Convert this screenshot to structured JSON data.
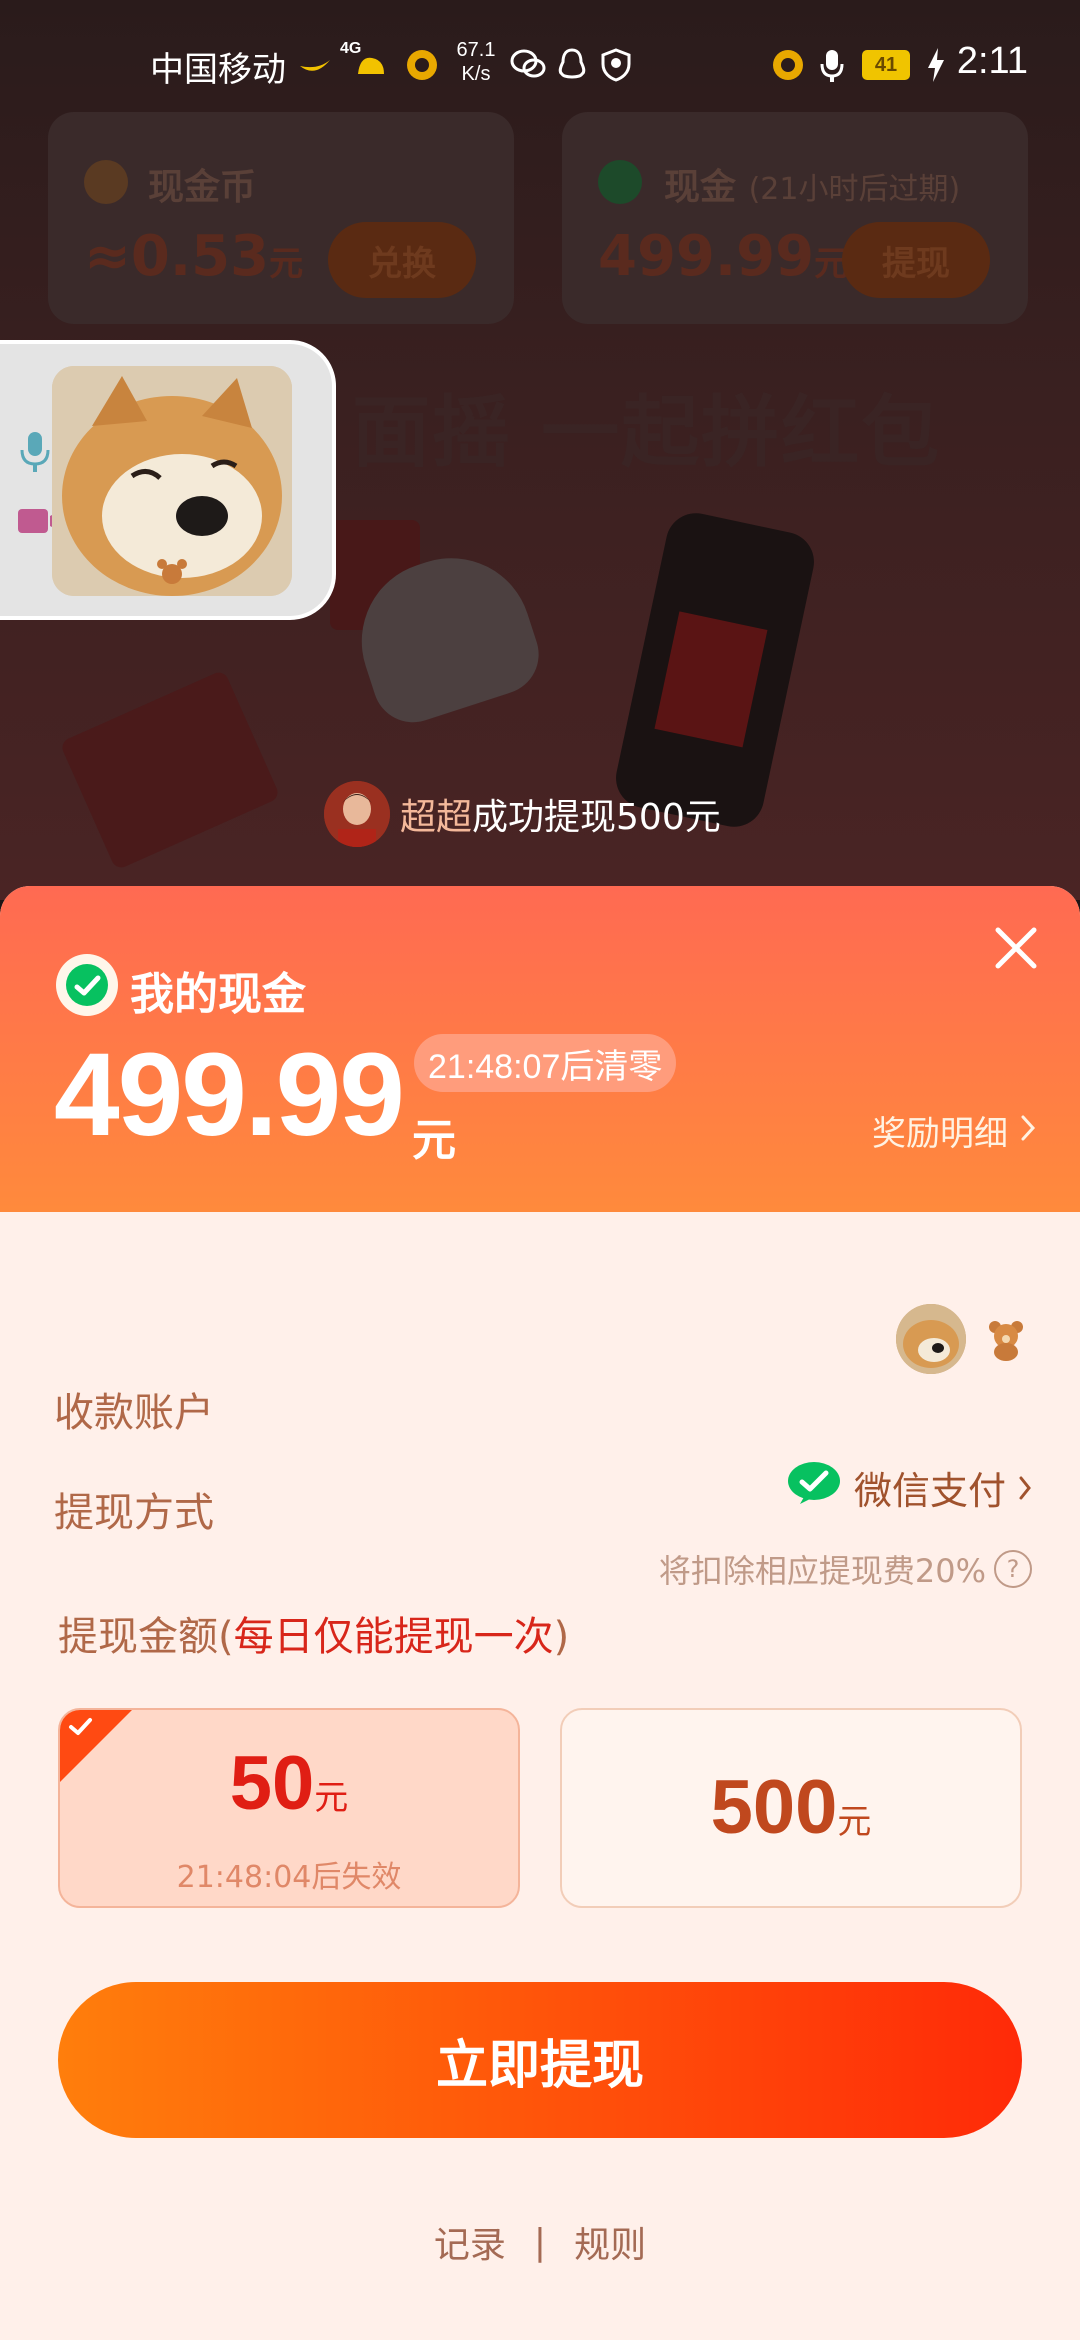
{
  "status_bar": {
    "carrier": "中国移动",
    "speed_value": "67.1",
    "speed_unit": "K/s",
    "battery": "41",
    "time": "2:11"
  },
  "background": {
    "card_coins": {
      "title": "现金币",
      "value": "≈0.53",
      "unit": "元",
      "button": "兑换"
    },
    "card_cash": {
      "title": "现金",
      "subtitle": "(21小时后过期)",
      "value": "499.99",
      "unit": "元",
      "button": "提现"
    },
    "headline": "面摇 一起拼红包"
  },
  "ticker": {
    "username": "超超",
    "message": "成功提现500元"
  },
  "sheet": {
    "title": "我的现金",
    "amount": "499.99",
    "unit": "元",
    "countdown": "21:48:07后清零",
    "reward_link": "奖励明细",
    "account_label": "收款账户",
    "method_label": "提现方式",
    "method_value": "微信支付",
    "fee_note": "将扣除相应提现费20%",
    "fee_help": "?",
    "amount_label_prefix": "提现金额(",
    "amount_label_highlight": "每日仅能提现一次",
    "amount_label_suffix": ")",
    "options": [
      {
        "value": "50",
        "unit": "元",
        "expiry": "21:48:04后失效",
        "selected": true
      },
      {
        "value": "500",
        "unit": "元",
        "expiry": "",
        "selected": false
      }
    ],
    "cta": "立即提现",
    "footer": {
      "records": "记录",
      "separator": "|",
      "rules": "规则"
    }
  },
  "colors": {
    "header_gradient_start": "#ff6a52",
    "header_gradient_end": "#ff8a3c",
    "cta_start": "#ff7e0c",
    "cta_end": "#ff2a08",
    "wechat_green": "#07c160",
    "highlight_red": "#d8261a"
  },
  "icons": {
    "close": "close-icon",
    "wechat": "wechat-pay-icon",
    "chevron": "chevron-right-icon",
    "mic": "microphone-icon",
    "camera": "video-camera-icon",
    "check": "checkmark-icon"
  }
}
